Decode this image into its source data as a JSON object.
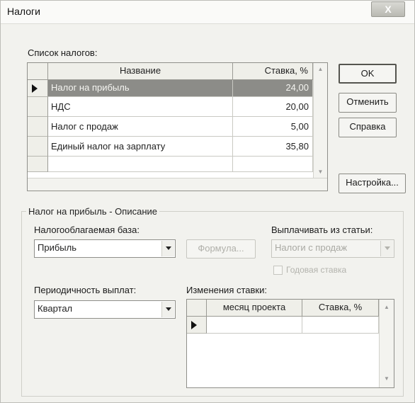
{
  "window": {
    "title": "Налоги",
    "close_glyph": "X"
  },
  "taxes_section": {
    "label": "Список налогов:",
    "columns": {
      "name": "Название",
      "rate": "Ставка, %"
    },
    "rows": [
      {
        "name": "Налог на прибыль",
        "rate": "24,00",
        "selected": true
      },
      {
        "name": "НДС",
        "rate": "20,00",
        "selected": false
      },
      {
        "name": "Налог с продаж",
        "rate": "5,00",
        "selected": false
      },
      {
        "name": "Единый налог на зарплату",
        "rate": "35,80",
        "selected": false
      }
    ]
  },
  "buttons": {
    "ok": "OK",
    "cancel": "Отменить",
    "help": "Справка",
    "settings": "Настройка...",
    "formula": "Формула..."
  },
  "description": {
    "title": "Налог на прибыль - Описание",
    "tax_base_label": "Налогооблагаемая база:",
    "tax_base_value": "Прибыль",
    "pay_from_label": "Выплачивать из статьи:",
    "pay_from_value": "Налоги с продаж",
    "annual_rate_label": "Годовая ставка",
    "annual_rate_checked": false,
    "periodicity_label": "Периодичность выплат:",
    "periodicity_value": "Квартал",
    "rate_changes_label": "Изменения ставки:",
    "rate_changes_columns": {
      "month": "месяц проекта",
      "rate": "Ставка, %"
    }
  },
  "icons": {
    "row_pointer": "row-pointer-icon",
    "dropdown": "chevron-down-icon",
    "scroll_up": "scroll-up-arrow",
    "scroll_down": "scroll-down-arrow"
  }
}
